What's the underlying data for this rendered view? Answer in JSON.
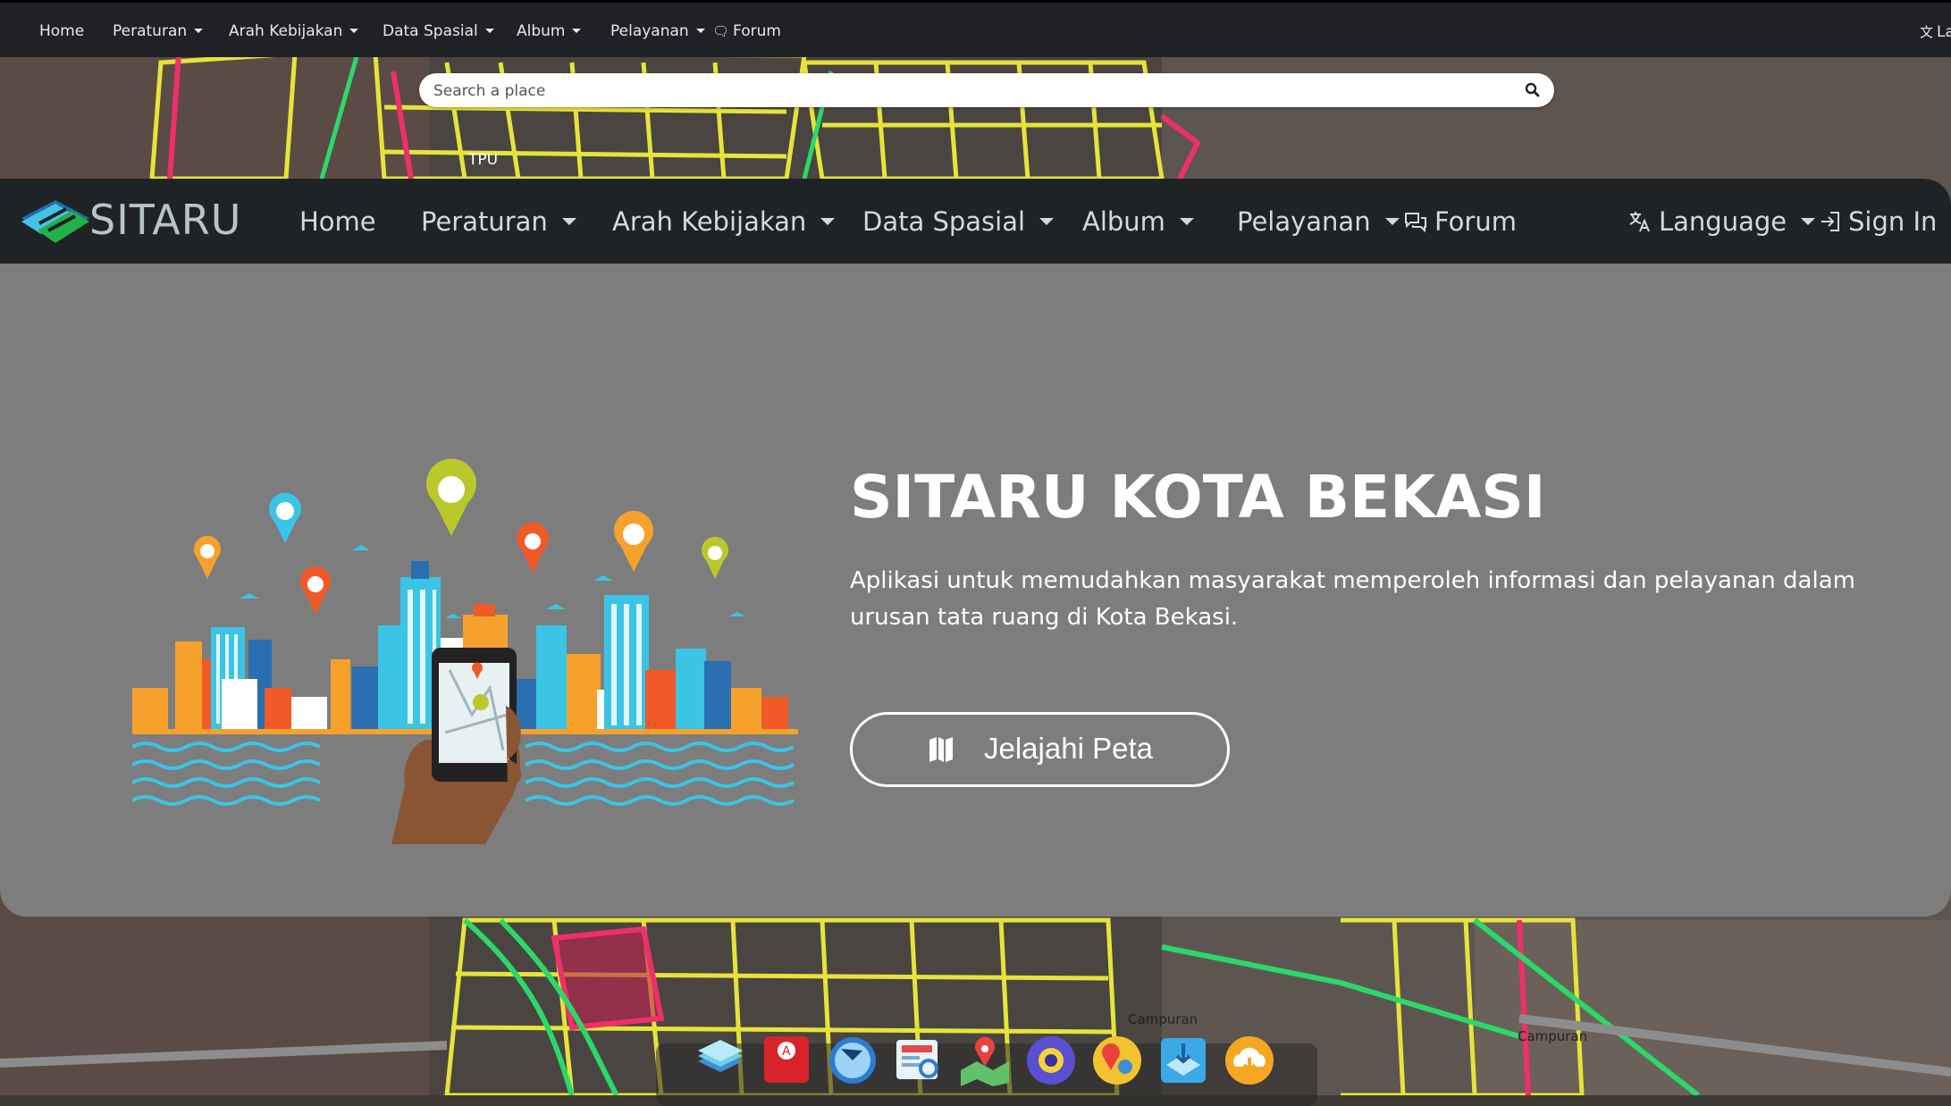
{
  "topbar": {
    "items": [
      {
        "label": "Home",
        "dropdown": false
      },
      {
        "label": "Peraturan",
        "dropdown": true
      },
      {
        "label": "Arah Kebijakan",
        "dropdown": true
      },
      {
        "label": "Data Spasial",
        "dropdown": true
      },
      {
        "label": "Album",
        "dropdown": true
      },
      {
        "label": "Pelayanan",
        "dropdown": true
      },
      {
        "label": "Forum",
        "icon": "forum-icon"
      }
    ],
    "lang_partial": "La"
  },
  "search": {
    "placeholder": "Search a place",
    "icon": "search-icon"
  },
  "map_labels": [
    "TPU",
    "Campuran",
    "Campuran"
  ],
  "nav": {
    "brand": "SITARU",
    "items": [
      {
        "label": "Home",
        "dropdown": false
      },
      {
        "label": "Peraturan",
        "dropdown": true
      },
      {
        "label": "Arah Kebijakan",
        "dropdown": true
      },
      {
        "label": "Data Spasial",
        "dropdown": true
      },
      {
        "label": "Album",
        "dropdown": true
      },
      {
        "label": "Pelayanan",
        "dropdown": true
      },
      {
        "label": "Forum",
        "icon": "forum-icon"
      }
    ],
    "language": {
      "label": "Language",
      "icon": "translate-icon"
    },
    "signin": {
      "label": "Sign In",
      "icon": "sign-in-icon"
    }
  },
  "hero": {
    "title": "SITARU KOTA BEKASI",
    "description": "Aplikasi untuk memudahkan masyarakat memperoleh informasi dan pelayanan dalam urusan tata ruang di Kota Bekasi.",
    "cta": {
      "label": "Jelajahi Peta",
      "icon": "map-icon"
    }
  },
  "dock": [
    "layers-icon",
    "pin-a-icon",
    "compass-icon",
    "news-search-icon",
    "map-pin-icon",
    "camera-globe-icon",
    "location-icon",
    "transfer-icon",
    "cloud-download-icon"
  ],
  "colors": {
    "navbar": "#202326",
    "panel": "#7d7d7d",
    "accent": "#ffffff"
  }
}
